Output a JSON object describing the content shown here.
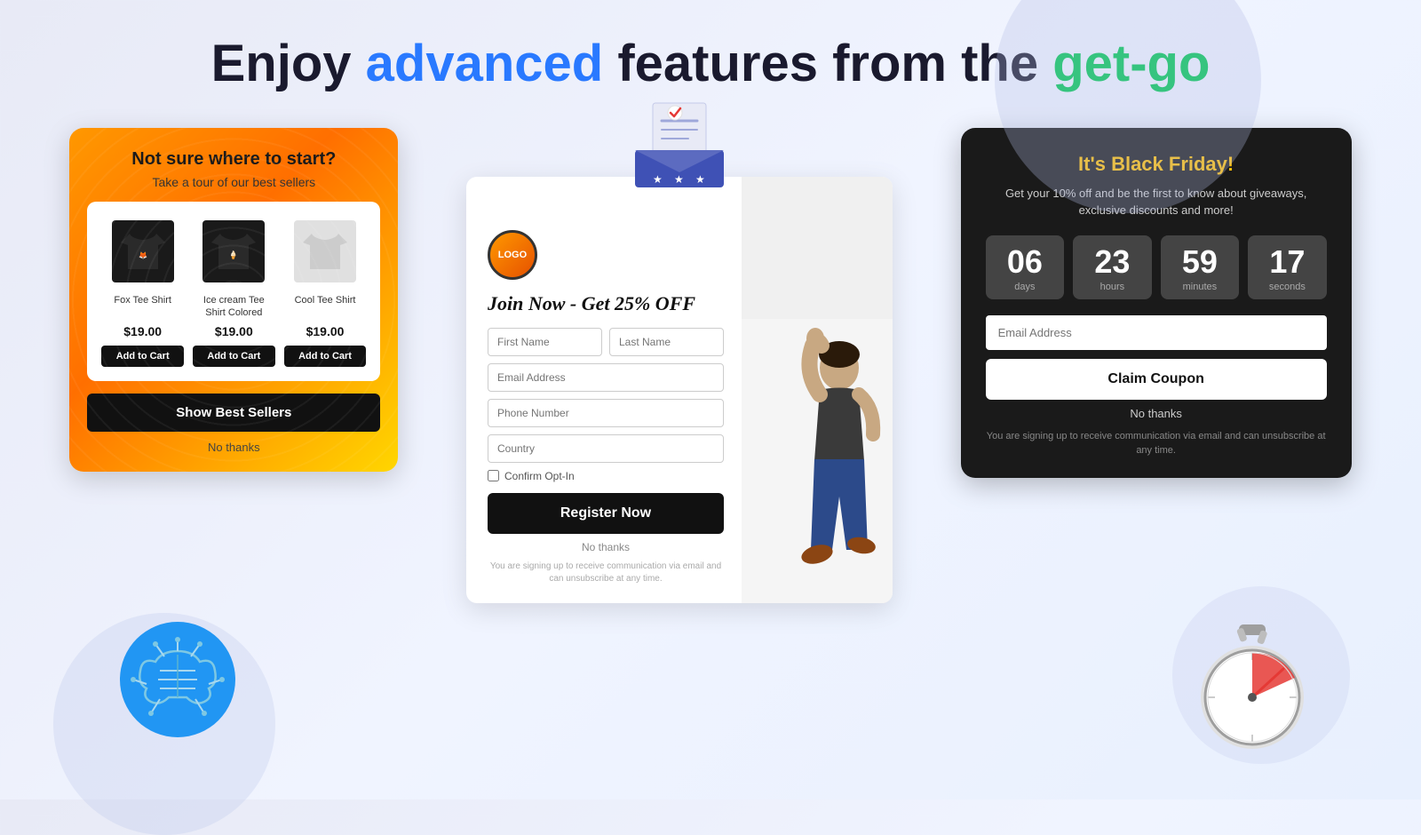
{
  "page": {
    "title_part1": "Enjoy ",
    "title_advanced": "advanced",
    "title_part2": " features from the ",
    "title_getgo": "get-go"
  },
  "bestsellers_card": {
    "title": "Not sure where to start?",
    "subtitle": "Take a tour of our best sellers",
    "products": [
      {
        "name": "Fox Tee Shirt",
        "price": "$19.00",
        "btn": "Add to Cart"
      },
      {
        "name": "Ice cream Tee Shirt Colored",
        "price": "$19.00",
        "btn": "Add to Cart"
      },
      {
        "name": "Cool Tee Shirt",
        "price": "$19.00",
        "btn": "Add to Cart"
      }
    ],
    "show_btn": "Show Best Sellers",
    "no_thanks": "No thanks"
  },
  "form_card": {
    "logo_text": "LOGO",
    "headline": "Join Now - Get 25% OFF",
    "fields": {
      "first_name": "First Name",
      "last_name": "Last Name",
      "email": "Email Address",
      "phone": "Phone Number",
      "country": "Country"
    },
    "checkbox_label": "Confirm Opt-In",
    "register_btn": "Register Now",
    "no_thanks": "No thanks",
    "disclaimer": "You are signing up to receive communication via email and\ncan unsubscribe at any time."
  },
  "blackfriday_card": {
    "title": "It's Black Friday!",
    "description": "Get your 10% off and be the first to know about\ngiveaways, exclusive discounts and more!",
    "countdown": {
      "days": "06",
      "days_label": "days",
      "hours": "23",
      "hours_label": "hours",
      "minutes": "59",
      "minutes_label": "minutes",
      "seconds": "17",
      "seconds_label": "seconds"
    },
    "email_placeholder": "Email Address",
    "claim_btn": "Claim Coupon",
    "no_thanks": "No thanks",
    "disclaimer": "You are signing up to receive communication via email and can\nunsubscribe at any time."
  }
}
